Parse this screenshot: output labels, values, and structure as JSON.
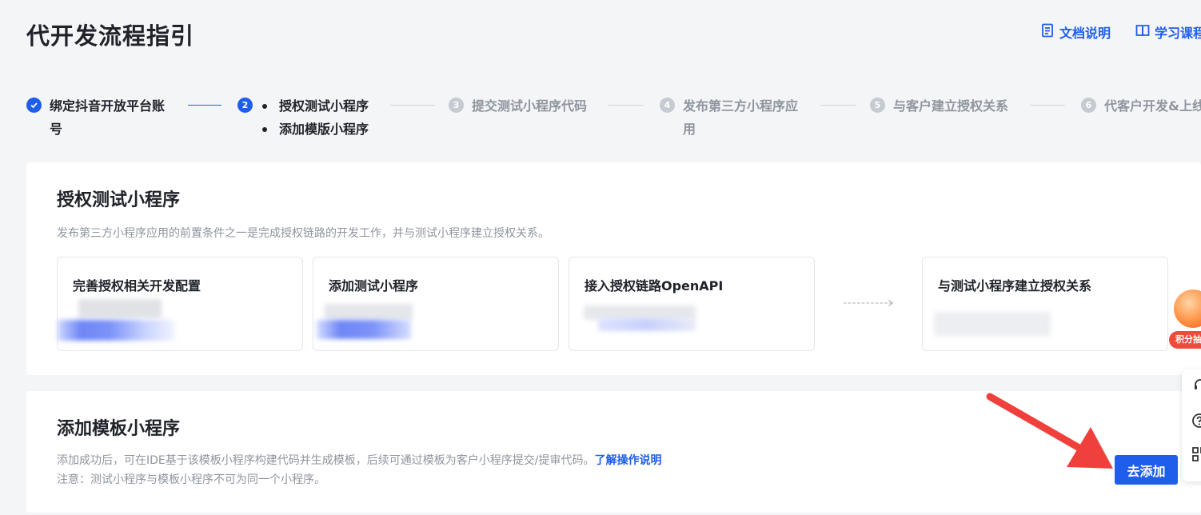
{
  "header": {
    "title": "代开发流程指引",
    "doc_link": "文档说明",
    "course_link": "学习课程"
  },
  "steps": [
    {
      "num": "",
      "label": "绑定抖音开放平台账号",
      "label_line1": "绑定抖音开放平台账",
      "label_line2": "号",
      "state": "done"
    },
    {
      "num": "2",
      "sub_items": [
        "授权测试小程序",
        "添加模版小程序"
      ],
      "state": "active"
    },
    {
      "num": "3",
      "label": "提交测试小程序代码",
      "state": "todo"
    },
    {
      "num": "4",
      "label_line1": "发布第三方小程序应",
      "label_line2": "用",
      "state": "todo"
    },
    {
      "num": "5",
      "label": "与客户建立授权关系",
      "state": "todo"
    },
    {
      "num": "6",
      "label": "代客户开发&上线",
      "state": "todo"
    }
  ],
  "auth_section": {
    "title": "授权测试小程序",
    "description": "发布第三方小程序应用的前置条件之一是完成授权链路的开发工作，并与测试小程序建立授权关系。",
    "cards": [
      {
        "title": "完善授权相关开发配置"
      },
      {
        "title": "添加测试小程序"
      },
      {
        "title": "接入授权链路OpenAPI"
      },
      {
        "title": "与测试小程序建立授权关系"
      }
    ]
  },
  "template_section": {
    "title": "添加模板小程序",
    "description": "添加成功后，可在IDE基于该模板小程序构建代码并生成模板，后续可通过模板为客户小程序提交/提审代码。",
    "link": "了解操作说明",
    "note": "注意：测试小程序与模板小程序不可为同一个小程序。",
    "button": "去添加"
  },
  "float_badge": {
    "label": "积分抽奖"
  },
  "colors": {
    "accent": "#1f5eea",
    "annotation_arrow": "#f0403c"
  }
}
